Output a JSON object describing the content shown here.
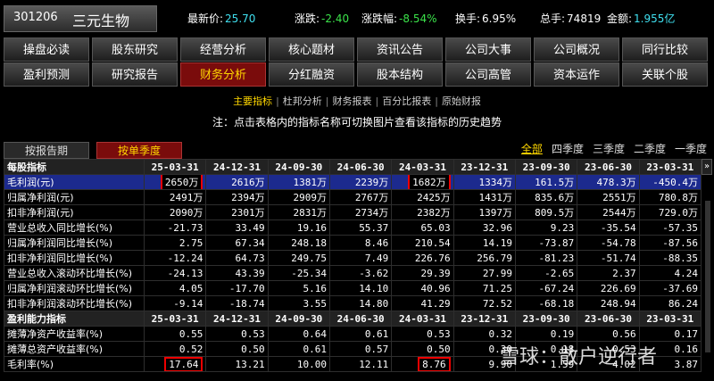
{
  "stock": {
    "code": "301206",
    "name": "三元生物"
  },
  "quotes": [
    {
      "label": "最新价:",
      "value": "25.70",
      "color": "cyan"
    },
    {
      "label": "涨跌:",
      "value": "-2.40",
      "color": "green"
    },
    {
      "label": "涨跌幅:",
      "value": "-8.54%",
      "color": "green"
    },
    {
      "label": "换手:",
      "value": "6.95%",
      "color": "white"
    },
    {
      "label": "总手:",
      "value": "74819",
      "color": "white"
    },
    {
      "label": "金额:",
      "value": "1.955亿",
      "color": "cyan"
    }
  ],
  "nav_row1": [
    "操盘必读",
    "股东研究",
    "经营分析",
    "核心题材",
    "资讯公告",
    "公司大事",
    "公司概况",
    "同行比较"
  ],
  "nav_row2": [
    "盈利预测",
    "研究报告",
    "财务分析",
    "分红融资",
    "股本结构",
    "公司高管",
    "资本运作",
    "关联个股"
  ],
  "active_nav": "财务分析",
  "subnav": [
    "主要指标",
    "杜邦分析",
    "财务报表",
    "百分比报表",
    "原始财报"
  ],
  "subnav_selected": "主要指标",
  "note": "注：点击表格内的指标名称可切换图片查看该指标的历史趋势",
  "tabs": {
    "period": "按报告期",
    "quarter": "按单季度"
  },
  "filters": [
    "全部",
    "四季度",
    "三季度",
    "二季度",
    "一季度"
  ],
  "scroll_arrow": "»",
  "table": {
    "header1": {
      "title": "每股指标",
      "cols": [
        "25-03-31",
        "24-12-31",
        "24-09-30",
        "24-06-30",
        "24-03-31",
        "23-12-31",
        "23-09-30",
        "23-06-30",
        "23-03-31"
      ]
    },
    "rows1": [
      {
        "name": "毛利润(元)",
        "values": [
          "2650万",
          "2616万",
          "1381万",
          "2239万",
          "1682万",
          "1334万",
          "161.5万",
          "478.3万",
          "-450.4万"
        ],
        "selected": true,
        "boxed": [
          0,
          4
        ]
      },
      {
        "name": "归属净利润(元)",
        "values": [
          "2491万",
          "2394万",
          "2909万",
          "2767万",
          "2425万",
          "1431万",
          "835.6万",
          "2551万",
          "780.8万"
        ]
      },
      {
        "name": "扣非净利润(元)",
        "values": [
          "2090万",
          "2301万",
          "2831万",
          "2734万",
          "2382万",
          "1397万",
          "809.5万",
          "2544万",
          "729.0万"
        ]
      },
      {
        "name": "营业总收入同比增长(%)",
        "values": [
          "-21.73",
          "33.49",
          "19.16",
          "55.37",
          "65.03",
          "32.96",
          "9.23",
          "-35.54",
          "-57.35"
        ]
      },
      {
        "name": "归属净利润同比增长(%)",
        "values": [
          "2.75",
          "67.34",
          "248.18",
          "8.46",
          "210.54",
          "14.19",
          "-73.87",
          "-54.78",
          "-87.56"
        ]
      },
      {
        "name": "扣非净利润同比增长(%)",
        "values": [
          "-12.24",
          "64.73",
          "249.75",
          "7.49",
          "226.76",
          "256.79",
          "-81.23",
          "-51.74",
          "-88.35"
        ]
      },
      {
        "name": "营业总收入滚动环比增长(%)",
        "values": [
          "-24.13",
          "43.39",
          "-25.34",
          "-3.62",
          "29.39",
          "27.99",
          "-2.65",
          "2.37",
          "4.24"
        ]
      },
      {
        "name": "归属净利润滚动环比增长(%)",
        "values": [
          "4.05",
          "-17.70",
          "5.16",
          "14.10",
          "40.96",
          "71.25",
          "-67.24",
          "226.69",
          "-37.69"
        ]
      },
      {
        "name": "扣非净利润滚动环比增长(%)",
        "values": [
          "-9.14",
          "-18.74",
          "3.55",
          "14.80",
          "41.29",
          "72.52",
          "-68.18",
          "248.94",
          "86.24"
        ]
      }
    ],
    "header2": {
      "title": "盈利能力指标",
      "cols": [
        "25-03-31",
        "24-12-31",
        "24-09-30",
        "24-06-30",
        "24-03-31",
        "23-12-31",
        "23-09-30",
        "23-06-30",
        "23-03-31"
      ]
    },
    "rows2": [
      {
        "name": "摊薄净资产收益率(%)",
        "values": [
          "0.55",
          "0.53",
          "0.64",
          "0.61",
          "0.53",
          "0.32",
          "0.19",
          "0.56",
          "0.17"
        ]
      },
      {
        "name": "摊薄总资产收益率(%)",
        "values": [
          "0.52",
          "0.50",
          "0.61",
          "0.57",
          "0.50",
          "0.30",
          "0.18",
          "0.53",
          "0.16"
        ]
      },
      {
        "name": "毛利率(%)",
        "values": [
          "17.64",
          "13.21",
          "10.00",
          "12.11",
          "8.76",
          "9.90",
          "1.59",
          "4.02",
          "3.87"
        ],
        "boxed": [
          0,
          4
        ]
      }
    ]
  },
  "watermark": "雪球：散户逆行者"
}
